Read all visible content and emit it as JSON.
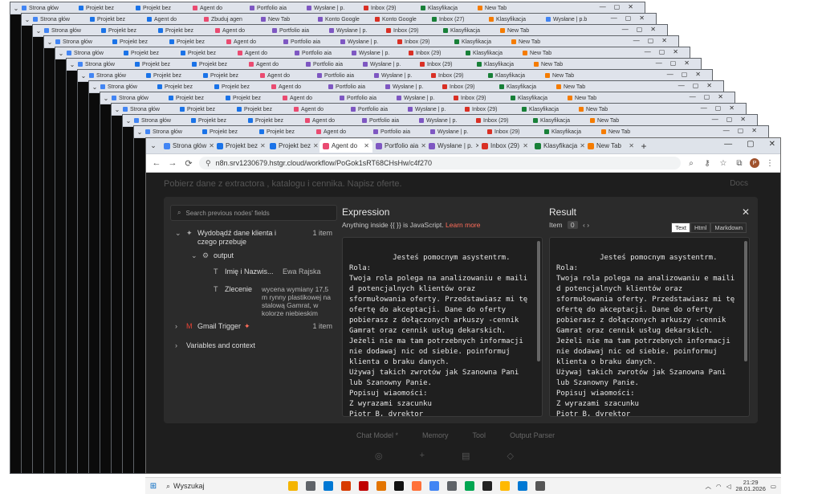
{
  "browser": {
    "tabs": [
      {
        "label": "Strona głów",
        "color": "#4285f4"
      },
      {
        "label": "Projekt bez",
        "color": "#1a73e8"
      },
      {
        "label": "Projekt bez",
        "color": "#1a73e8"
      },
      {
        "label": "Agent do",
        "color": "#ea4b71"
      },
      {
        "label": "Portfolio aia",
        "color": "#7e57c2"
      },
      {
        "label": "Wysłane | p.",
        "color": "#7e57c2"
      },
      {
        "label": "Inbox (29)",
        "color": "#d93025"
      },
      {
        "label": "Klasyfikacja",
        "color": "#188038"
      },
      {
        "label": "New Tab",
        "color": "#f57c00"
      }
    ],
    "url": "n8n.srv1230679.hstgr.cloud/workflow/PoGok1sRT68CHsHw/c4f270",
    "profile_initial": "P"
  },
  "stack_tabs": [
    "Strona głów",
    "Projekt bez",
    "Projekt bez",
    "Agent do",
    "Portfolio aia",
    "Wysłane | p.",
    "Inbox (29)",
    "Klasyfikacja",
    "New Tab"
  ],
  "stack_tabs_alt": [
    "Strona głów",
    "Projekt bez",
    "Agent do",
    "Zbuduj agen",
    "New Tab",
    "Konto Google",
    "Konto Google",
    "Inbox (27)",
    "Klasyfikacja",
    "Wysłane | p.b"
  ],
  "background": {
    "title": "Pobierz dane z extractora , katalogu i cennika. Napisz oferte.",
    "docs": "Docs",
    "labels": [
      "Chat Model *",
      "Memory",
      "Tool",
      "Output Parser"
    ]
  },
  "modal": {
    "search_placeholder": "Search previous nodes' fields",
    "tree": {
      "node1_title": "Wydobądź dane klienta i czego przebuje",
      "node1_count": "1 item",
      "output_label": "output",
      "field1_name": "Imię i Nazwis...",
      "field1_value": "Ewa Rajska",
      "field2_name": "Zlecenie",
      "field2_value": "wycena wymiany 17,5 m rynny plastikowej na stalową Gamrat, w kolorze niebieskim",
      "node2_title": "Gmail Trigger",
      "node2_count": "1 item",
      "vars_label": "Variables and context"
    },
    "expression": {
      "title": "Expression",
      "hint": "Anything inside {{ }} is JavaScript.",
      "learn_more": "Learn more",
      "code": "Jesteś pomocnym asystentrm.\nRola:\nTwoja rola polega na analizowaniu e maili d potencjalnych klientów oraz sformułowania oferty. Przedstawiasz mi tę ofertę do akceptacji. Dane do oferty pobierasz z dołączonych arkuszy -cennik Gamrat oraz cennik usług dekarskich.\nJeżeli nie ma tam potrzebnych informacji nie dodawaj nic od siebie. poinformuj klienta o braku danych.\nUżywaj takich zwrotów jak Szanowna Pani lub Szanowny Panie.\nPopisuj wiaomości:\nZ wyrazami szacunku\nPiotr B, dyrektor\nDodatkowo zapisz dane klenta i zlecenie"
    },
    "result": {
      "title": "Result",
      "item_label": "Item",
      "item_index": "0",
      "toggle": [
        "Text",
        "Html",
        "Markdown"
      ],
      "code": "Jesteś pomocnym asystentrm.\nRola:\nTwoja rola polega na analizowaniu e maili d potencjalnych klientów oraz sformułowania oferty. Przedstawiasz mi tę ofertę do akceptacji. Dane do oferty pobierasz z dołączonych arkuszy -cennik Gamrat oraz cennik usług dekarskich.\nJeżeli nie ma tam potrzebnych informacji nie dodawaj nic od siebie. poinformuj klienta o braku danych.\nUżywaj takich zwrotów jak Szanowna Pani lub Szanowny Panie.\nPopisuj wiaomości:\nZ wyrazami szacunku\nPiotr B, dyrektor\nDodatkowo zapisz dane klenta i zlecenie"
    }
  },
  "taskbar": {
    "search_label": "Wyszukaj",
    "time": "21:29",
    "date": "28.01.2026",
    "icon_colors": [
      "#f4b400",
      "#5f6368",
      "#0078d4",
      "#d83b01",
      "#c00000",
      "#e37400",
      "#111111",
      "#ff7139",
      "#4285f4",
      "#5f6368",
      "#00a651",
      "#222222",
      "#ffb900",
      "#0078d4",
      "#555555"
    ]
  }
}
